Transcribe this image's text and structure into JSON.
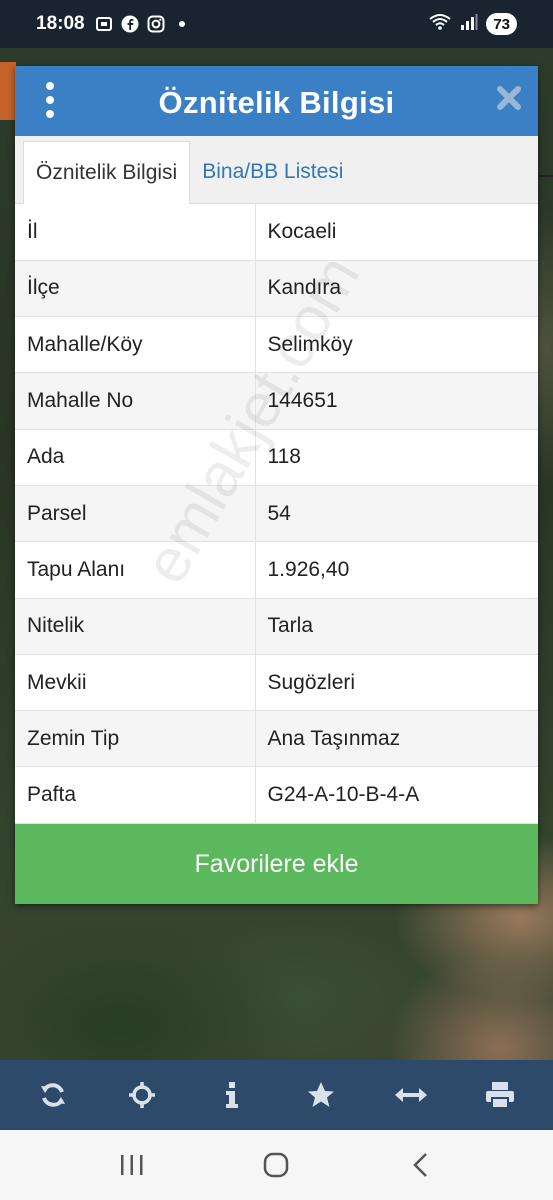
{
  "status_bar": {
    "time": "18:08",
    "battery": "73",
    "icons": [
      "screenshot-icon",
      "facebook-icon",
      "instagram-icon",
      "dot-icon",
      "wifi-icon",
      "signal-icon"
    ]
  },
  "dialog": {
    "title": "Öznitelik Bilgisi",
    "tabs": [
      {
        "label": "Öznitelik Bilgisi",
        "active": true
      },
      {
        "label": "Bina/BB Listesi",
        "active": false
      }
    ],
    "rows": [
      {
        "key": "İl",
        "value": "Kocaeli"
      },
      {
        "key": "İlçe",
        "value": "Kandıra"
      },
      {
        "key": "Mahalle/Köy",
        "value": "Selimköy"
      },
      {
        "key": "Mahalle No",
        "value": "144651"
      },
      {
        "key": "Ada",
        "value": "118"
      },
      {
        "key": "Parsel",
        "value": "54"
      },
      {
        "key": "Tapu Alanı",
        "value": "1.926,40"
      },
      {
        "key": "Nitelik",
        "value": "Tarla"
      },
      {
        "key": "Mevkii",
        "value": "Sugözleri"
      },
      {
        "key": "Zemin Tip",
        "value": "Ana Taşınmaz"
      },
      {
        "key": "Pafta",
        "value": "G24-A-10-B-4-A"
      }
    ],
    "favorite_button": "Favorilere ekle"
  },
  "watermark": "emlakjet.com",
  "toolbar": [
    "refresh-icon",
    "locate-icon",
    "info-icon",
    "star-icon",
    "measure-icon",
    "print-icon"
  ],
  "navbar": [
    "recents-icon",
    "home-icon",
    "back-icon"
  ],
  "colors": {
    "header": "#3b7fc4",
    "favorite": "#5cb85c",
    "toolbar": "#2e4a6b",
    "tab_link": "#3278b4"
  }
}
